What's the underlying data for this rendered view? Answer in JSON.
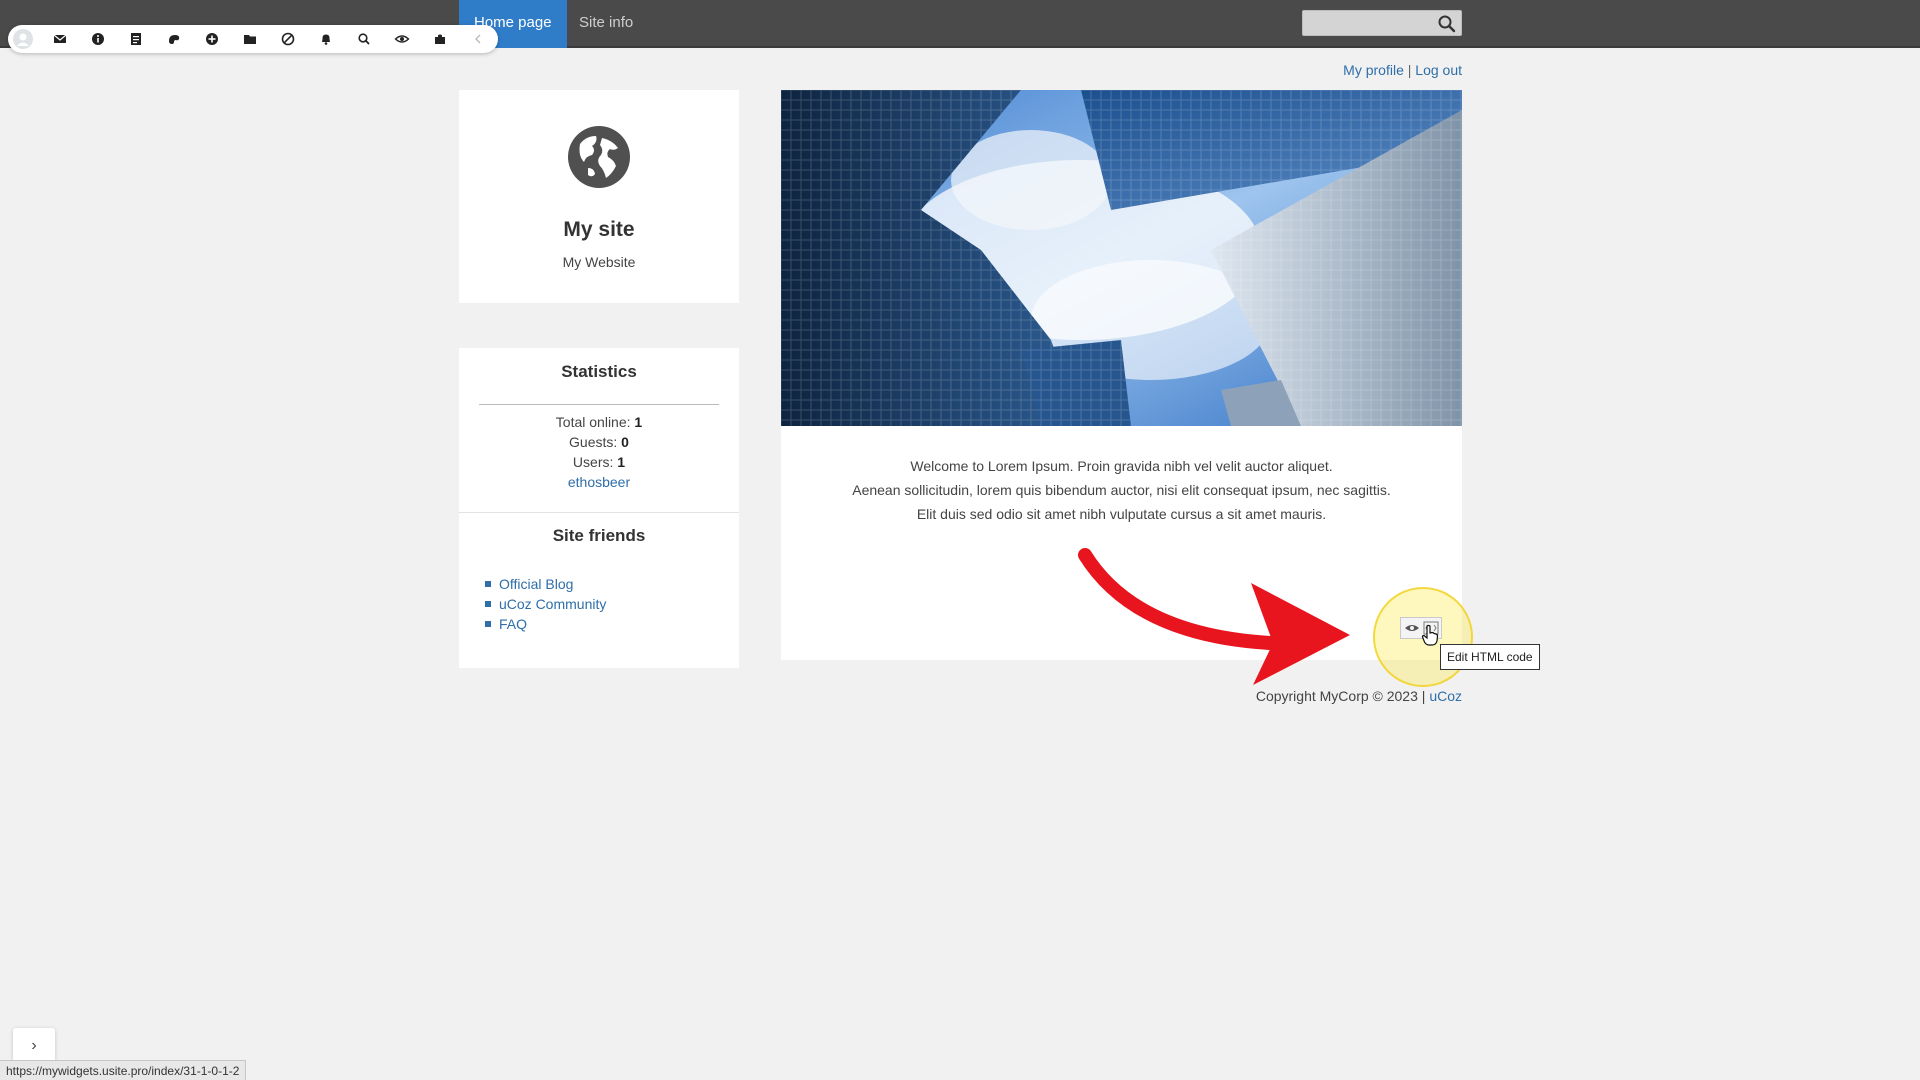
{
  "nav": {
    "tabs": [
      {
        "label": "Home page",
        "active": true
      },
      {
        "label": "Site info",
        "active": false
      }
    ],
    "search_placeholder": ""
  },
  "admin_toolbar": {
    "icons": [
      "avatar-icon",
      "mail-icon",
      "info-icon",
      "page-icon",
      "palette-icon",
      "plus-circle-icon",
      "folder-icon",
      "block-icon",
      "bell-icon",
      "search-icon",
      "eye-icon",
      "puzzle-icon",
      "chevron-left-icon"
    ]
  },
  "user_links": {
    "profile": "My profile",
    "separator": "|",
    "logout": "Log out"
  },
  "site": {
    "name": "My site",
    "tagline": "My Website"
  },
  "statistics": {
    "title": "Statistics",
    "total_online_label": "Total online:",
    "total_online": "1",
    "guests_label": "Guests:",
    "guests": "0",
    "users_label": "Users:",
    "users": "1",
    "user_name": "ethosbeer"
  },
  "friends": {
    "title": "Site friends",
    "items": [
      "Official Blog",
      "uCoz Community",
      "FAQ"
    ]
  },
  "welcome": {
    "line1": "Welcome to Lorem Ipsum. Proin gravida nibh vel velit auctor aliquet.",
    "line2": "Aenean sollicitudin, lorem quis bibendum auctor, nisi elit consequat ipsum, nec sagittis.",
    "line3": "Elit duis sed odio sit amet nibh vulputate cursus a sit amet mauris."
  },
  "editor": {
    "tooltip": "Edit HTML code",
    "icons": [
      "eye-icon",
      "edit-html-icon"
    ]
  },
  "footer": {
    "copyright": "Copyright MyCorp © 2023",
    "separator": "|",
    "link": "uCoz"
  },
  "status_bar": {
    "url": "https://mywidgets.usite.pro/index/31-1-0-1-2"
  },
  "side_toggle": {
    "glyph": "›"
  },
  "colors": {
    "nav_bg": "#4a4a4a",
    "nav_active": "#2f7cc9",
    "link": "#2f6ea8",
    "page_bg": "#f1f1f1",
    "arrow": "#e8141e",
    "highlight": "#f5dc2a"
  }
}
